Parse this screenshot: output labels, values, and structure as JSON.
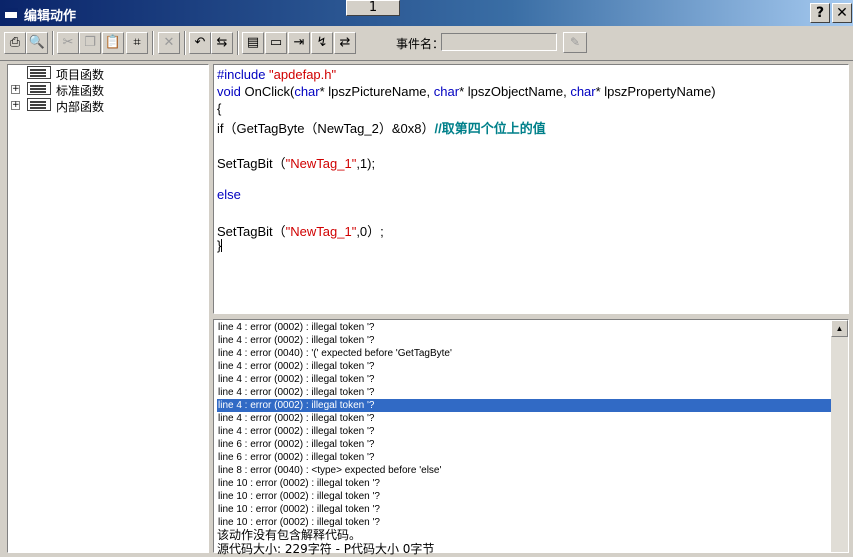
{
  "window": {
    "title": "编辑动作",
    "page_tab": "1",
    "help_label": "?",
    "close_label": "✕"
  },
  "toolbar": {
    "buttons": [
      {
        "icon": "print-icon",
        "glyph": "⎙"
      },
      {
        "icon": "print-preview-icon",
        "glyph": "🔍"
      },
      {
        "icon": "cut-icon",
        "glyph": "✂"
      },
      {
        "icon": "copy-icon",
        "glyph": "❐"
      },
      {
        "icon": "paste-icon",
        "glyph": "📋"
      },
      {
        "icon": "select-all-icon",
        "glyph": "⌗"
      },
      {
        "icon": "delete-icon",
        "glyph": "✕"
      },
      {
        "icon": "undo-icon",
        "glyph": "↶"
      },
      {
        "icon": "find-replace-icon",
        "glyph": "⇆"
      },
      {
        "icon": "bookmark-icon",
        "glyph": "▤"
      },
      {
        "icon": "comment-icon",
        "glyph": "▭"
      },
      {
        "icon": "indent-icon",
        "glyph": "⇥"
      },
      {
        "icon": "compile-icon",
        "glyph": "↯"
      },
      {
        "icon": "trigger-icon",
        "glyph": "⇄"
      }
    ],
    "event_name_label": "事件名：",
    "event_name_value": ""
  },
  "tree": {
    "items": [
      {
        "label": "项目函数",
        "expandable": false
      },
      {
        "label": "标准函数",
        "expandable": true,
        "expander": "+"
      },
      {
        "label": "内部函数",
        "expandable": true,
        "expander": "+"
      }
    ]
  },
  "code": {
    "include_directive": "#include ",
    "include_file": "\"apdefap.h\"",
    "void_kw": "void",
    "onclick_sig_1": " OnClick(",
    "char_kw": "char",
    "param1": "* lpszPictureName, ",
    "param2": "* lpszObjectName, ",
    "param3": "* lpszPropertyName)",
    "open_brace": "{",
    "if_line": "if（GetTagByte（NewTag_2）&0x8）",
    "if_comment": "//取第四个位上的值",
    "settag1_prefix": "SetTagBit（",
    "settag1_str": "\"NewTag_1\"",
    "settag1_suffix": ",1);",
    "else_kw": "else",
    "settag2_prefix": "SetTagBit（",
    "settag2_str": "\"NewTag_1\"",
    "settag2_suffix": ",0）;",
    "close_brace": "}"
  },
  "output": {
    "lines": [
      "line 4 : error (0002) : illegal token '?",
      "line 4 : error (0002) : illegal token '?",
      "line 4 : error (0040) : '(' expected before 'GetTagByte'",
      "line 4 : error (0002) : illegal token '?",
      "line 4 : error (0002) : illegal token '?",
      "line 4 : error (0002) : illegal token '?",
      "line 4 : error (0002) : illegal token '?",
      "line 4 : error (0002) : illegal token '?",
      "line 4 : error (0002) : illegal token '?",
      "line 6 : error (0002) : illegal token '?",
      "line 6 : error (0002) : illegal token '?",
      "line 8 : error (0040) : <type> expected before 'else'",
      "line 10 : error (0002) : illegal token '?",
      "line 10 : error (0002) : illegal token '?",
      "line 10 : error (0002) : illegal token '?",
      "line 10 : error (0002) : illegal token '?"
    ],
    "selected_index": 6,
    "summary_1": "该动作没有包含解释代码。",
    "summary_2": "源代码大小: 229字符 - P代码大小 0字节"
  }
}
